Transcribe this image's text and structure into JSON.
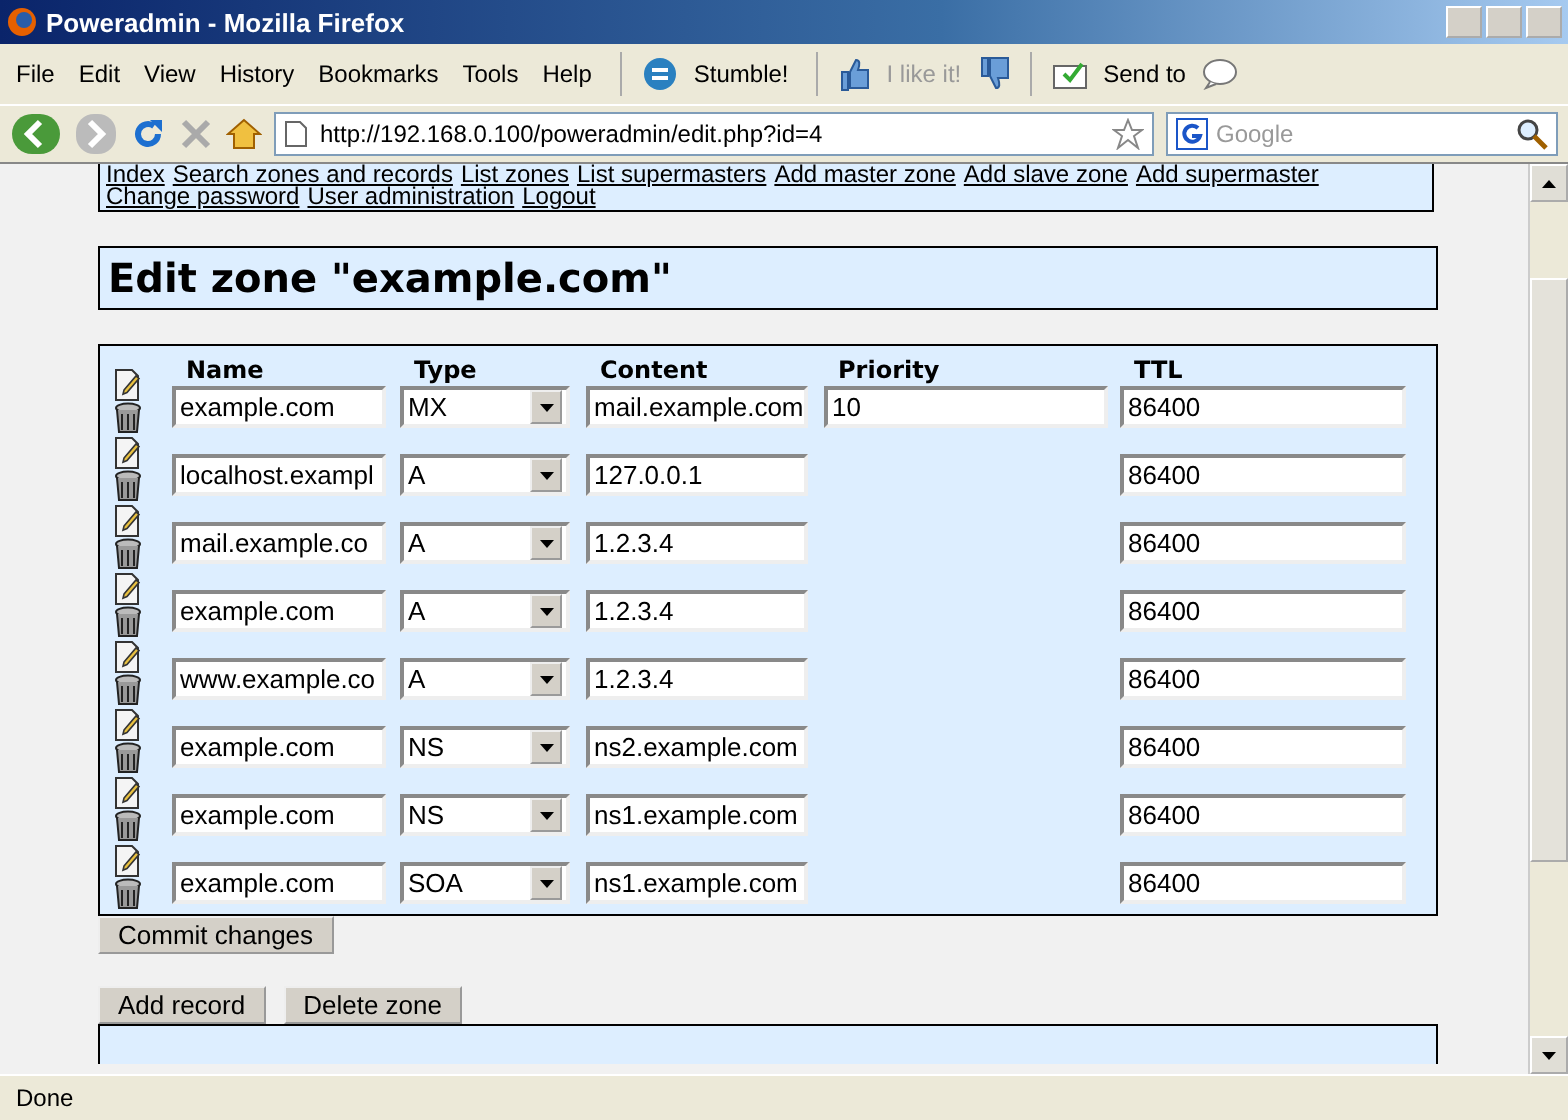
{
  "window": {
    "title": "Poweradmin - Mozilla Firefox"
  },
  "menu": [
    "File",
    "Edit",
    "View",
    "History",
    "Bookmarks",
    "Tools",
    "Help"
  ],
  "toolbar": {
    "stumble": "Stumble!",
    "like": "I like it!",
    "send": "Send to"
  },
  "address": {
    "url": "http://192.168.0.100/poweradmin/edit.php?id=4"
  },
  "search": {
    "placeholder": "Google"
  },
  "nav": [
    [
      "Index",
      "Search zones and records",
      "List zones",
      "List supermasters",
      "Add master zone",
      "Add slave zone",
      "Add supermaster"
    ],
    [
      "Change password",
      "User administration",
      "Logout"
    ]
  ],
  "heading": "Edit zone \"example.com\"",
  "table": {
    "columns": [
      "Name",
      "Type",
      "Content",
      "Priority",
      "TTL"
    ],
    "rows": [
      {
        "name": "example.com",
        "type": "MX",
        "content": "mail.example.com",
        "priority": "10",
        "ttl": "86400"
      },
      {
        "name": "localhost.exampl",
        "type": "A",
        "content": "127.0.0.1",
        "ttl": "86400"
      },
      {
        "name": "mail.example.co",
        "type": "A",
        "content": "1.2.3.4",
        "ttl": "86400"
      },
      {
        "name": "example.com",
        "type": "A",
        "content": "1.2.3.4",
        "ttl": "86400"
      },
      {
        "name": "www.example.co",
        "type": "A",
        "content": "1.2.3.4",
        "ttl": "86400"
      },
      {
        "name": "example.com",
        "type": "NS",
        "content": "ns2.example.com",
        "ttl": "86400"
      },
      {
        "name": "example.com",
        "type": "NS",
        "content": "ns1.example.com",
        "ttl": "86400"
      },
      {
        "name": "example.com",
        "type": "SOA",
        "content": "ns1.example.com",
        "ttl": "86400"
      }
    ]
  },
  "buttons": {
    "commit": "Commit changes",
    "actions": [
      "Add record",
      "Delete zone"
    ]
  },
  "status_bar": "Done"
}
